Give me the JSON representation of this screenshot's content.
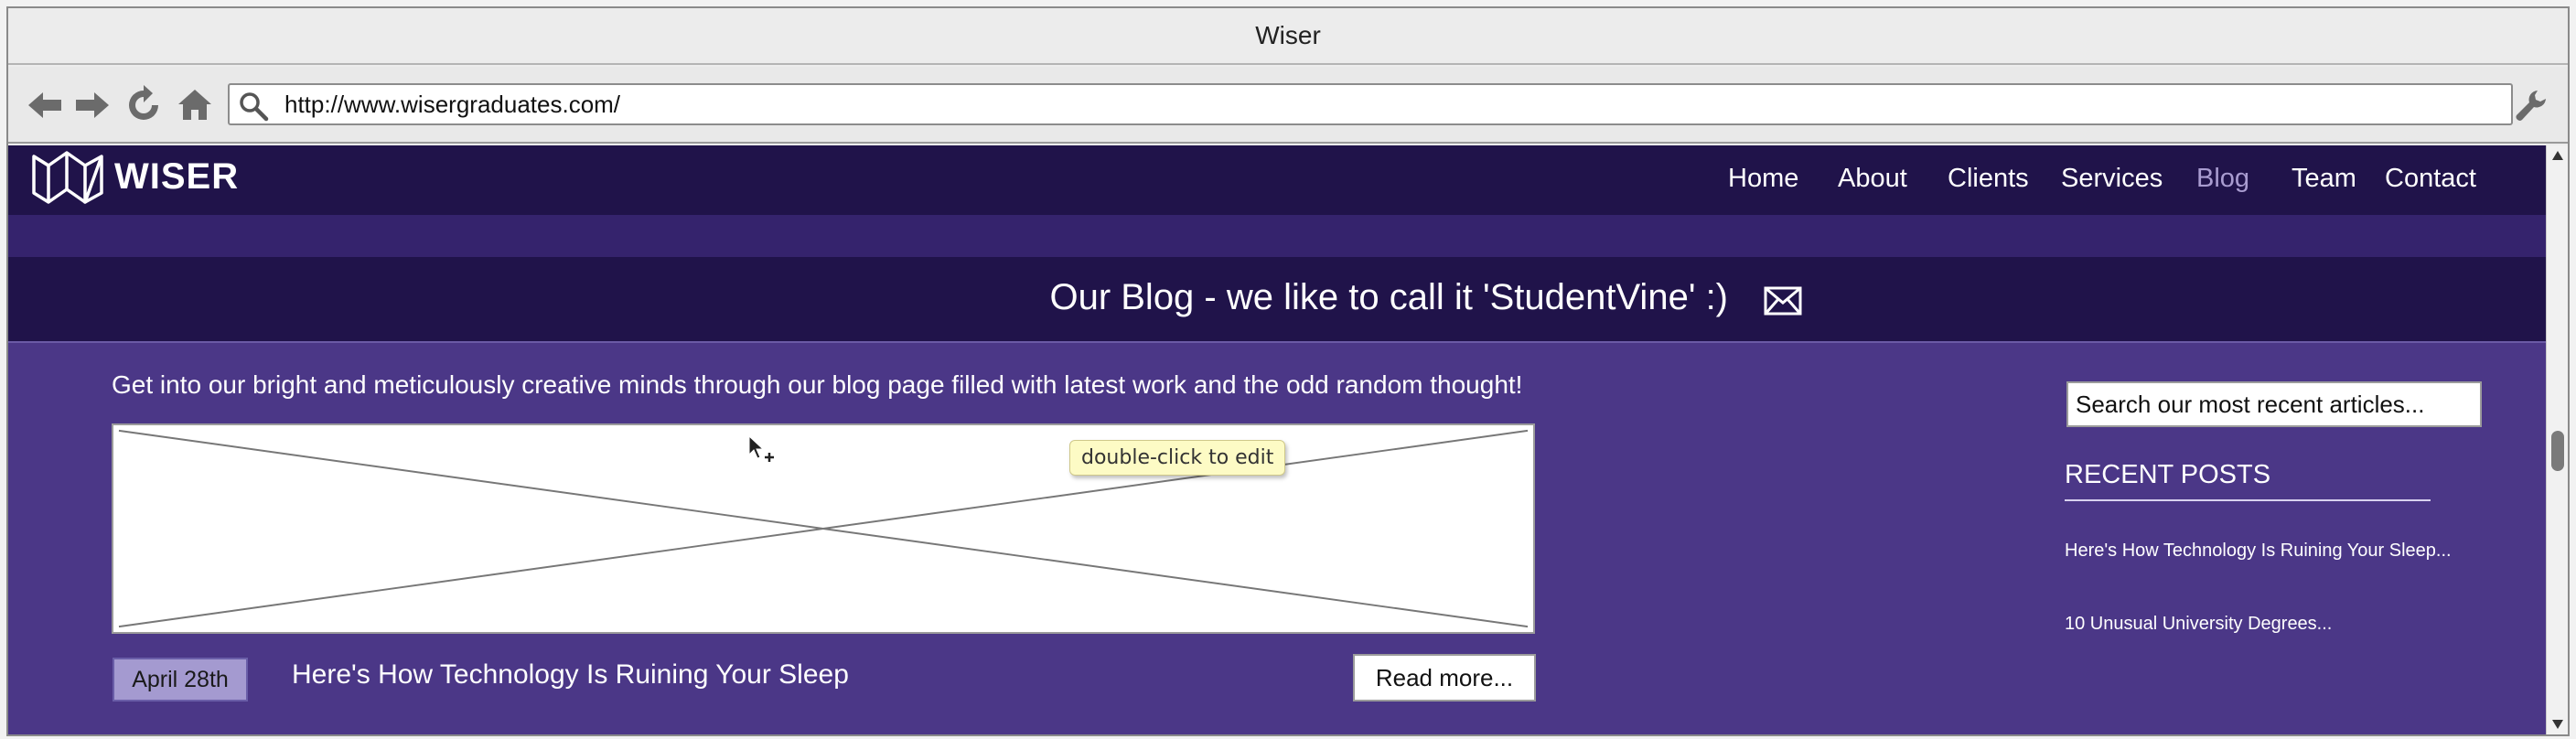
{
  "window": {
    "title": "Wiser"
  },
  "browser": {
    "url": "http://www.wisergraduates.com/"
  },
  "site": {
    "logo_text": "WISER",
    "nav": [
      {
        "label": "Home",
        "active": false
      },
      {
        "label": "About",
        "active": false
      },
      {
        "label": "Clients",
        "active": false
      },
      {
        "label": "Services",
        "active": false
      },
      {
        "label": "Blog",
        "active": true
      },
      {
        "label": "Team",
        "active": false
      },
      {
        "label": "Contact",
        "active": false
      }
    ],
    "colors": {
      "header": "#20134a",
      "band": "#35236d",
      "content": "#4b3787",
      "active_nav": "#a99cd0"
    }
  },
  "blog": {
    "title": "Our Blog - we like to call it 'StudentVine' :)",
    "intro": "Get into our bright and meticulously creative minds through our blog page filled with latest work and the odd random thought!",
    "tooltip": "double-click to edit",
    "post": {
      "date": "April 28th",
      "title": "Here's How Technology Is Ruining Your Sleep",
      "read_more": "Read more..."
    }
  },
  "sidebar": {
    "search_placeholder": "Search our most recent articles...",
    "recent_heading": "RECENT POSTS",
    "recent_posts": [
      "Here's How Technology Is Ruining Your Sleep...",
      "10 Unusual University Degrees..."
    ]
  }
}
